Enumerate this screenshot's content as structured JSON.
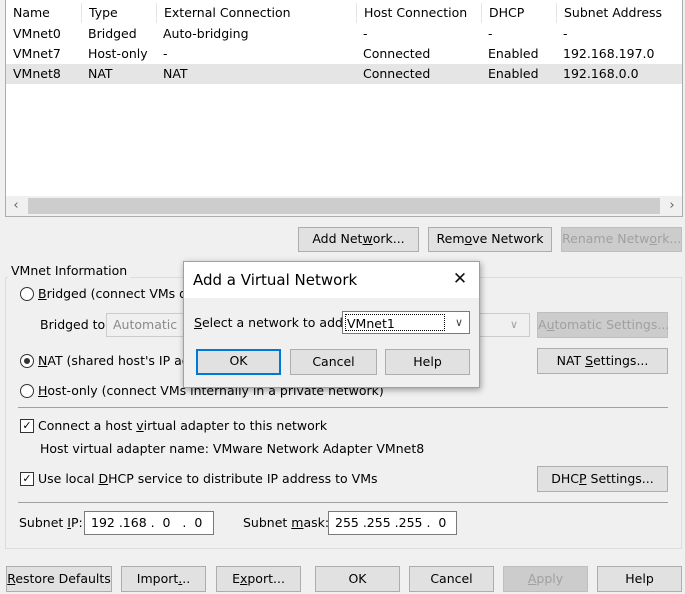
{
  "table": {
    "headers": [
      "Name",
      "Type",
      "External Connection",
      "Host Connection",
      "DHCP",
      "Subnet Address"
    ],
    "rows": [
      {
        "name": "VMnet0",
        "type": "Bridged",
        "external": "Auto-bridging",
        "host": "-",
        "dhcp": "-",
        "subnet": "-"
      },
      {
        "name": "VMnet7",
        "type": "Host-only",
        "external": "-",
        "host": "Connected",
        "dhcp": "Enabled",
        "subnet": "192.168.197.0"
      },
      {
        "name": "VMnet8",
        "type": "NAT",
        "external": "NAT",
        "host": "Connected",
        "dhcp": "Enabled",
        "subnet": "192.168.0.0"
      }
    ],
    "selected_row": "VMnet8"
  },
  "network_buttons": {
    "add_pre": "Add Net",
    "add_u": "w",
    "add_post": "ork...",
    "remove_pre": "Rem",
    "remove_u": "o",
    "remove_post": "ve Network",
    "rename_pre": "Rename Netw",
    "rename_u": "o",
    "rename_post": "rk..."
  },
  "vmnet_info": {
    "legend": "VMnet Information",
    "bridged": {
      "u": "B",
      "rest": "ridged (connect VMs dire"
    },
    "bridged_to_label": "Bridged to:",
    "bridged_to_value": "Automatic",
    "automatic_settings": {
      "pre": "A",
      "u": "u",
      "post": "tomatic Settings..."
    },
    "nat": {
      "u": "N",
      "rest": "AT (shared host's IP add"
    },
    "nat_settings": {
      "pre": "NAT ",
      "u": "S",
      "post": "ettings..."
    },
    "hostonly": {
      "u": "H",
      "rest": "ost-only (connect VMs internally in a private network)"
    },
    "connect_adapter": {
      "pre": "Connect a host ",
      "u": "v",
      "post": "irtual adapter to this network",
      "checked": true
    },
    "adapter_name_line": "Host virtual adapter name: VMware Network Adapter VMnet8",
    "dhcp_service": {
      "pre": "Use local ",
      "u": "D",
      "post": "HCP service to distribute IP address to VMs",
      "checked": true
    },
    "dhcp_settings": {
      "pre": "DHC",
      "u": "P",
      "post": " Settings..."
    },
    "subnet_ip_label": {
      "pre": "Subnet ",
      "u": "I",
      "post": "P:"
    },
    "subnet_ip_value": "192 .168 .  0   .  0",
    "subnet_mask_label": {
      "pre": "Subnet ",
      "u": "m",
      "post": "ask:"
    },
    "subnet_mask_value": "255 .255 .255 .  0"
  },
  "bottom_buttons": {
    "restore": {
      "u": "R",
      "rest": "estore Defaults"
    },
    "import": {
      "pre": "Import",
      "u": ".",
      "post": ".."
    },
    "export": {
      "pre": "E",
      "u": "x",
      "post": "port..."
    },
    "ok": "OK",
    "cancel": "Cancel",
    "apply": {
      "u": "A",
      "rest": "pply"
    },
    "help": "Help"
  },
  "dialog": {
    "title": "Add a Virtual Network",
    "select_label_u": "S",
    "select_label_rest": "elect a network to add:",
    "select_value": "VMnet1",
    "ok": "OK",
    "cancel": "Cancel",
    "help": "Help"
  },
  "colors": {
    "selected_row": "#e5e5e5",
    "default_button_border": "#0078d7",
    "window_bg": "#f0f0f0"
  }
}
